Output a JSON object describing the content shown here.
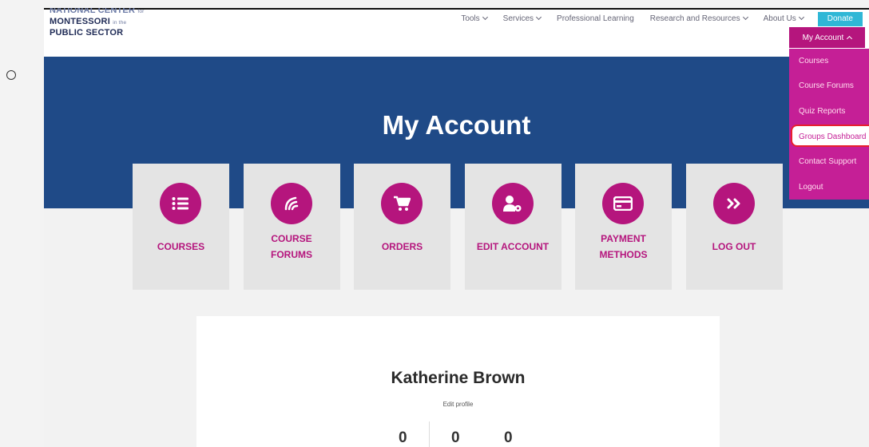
{
  "logo": {
    "line1": "NATIONAL CENTER",
    "line1_small": "for",
    "line2": "MONTESSORI",
    "line2_small": "in the",
    "line3": "PUBLIC SECTOR"
  },
  "nav": {
    "tools": "Tools",
    "services": "Services",
    "professional": "Professional Learning",
    "research": "Research and Resources",
    "about": "About Us",
    "donate": "Donate"
  },
  "account_menu": {
    "label": "My Account",
    "items": [
      "Courses",
      "Course Forums",
      "Quiz Reports",
      "Groups Dashboard",
      "Contact Support",
      "Logout"
    ]
  },
  "hero": {
    "title": "My Account"
  },
  "cards": [
    {
      "icon": "list-icon",
      "label": "COURSES"
    },
    {
      "icon": "forum-icon",
      "label": "COURSE FORUMS"
    },
    {
      "icon": "cart-icon",
      "label": "ORDERS"
    },
    {
      "icon": "user-gear-icon",
      "label": "EDIT ACCOUNT"
    },
    {
      "icon": "credit-card-icon",
      "label": "PAYMENT METHODS"
    },
    {
      "icon": "double-chevron-right-icon",
      "label": "LOG OUT"
    }
  ],
  "profile": {
    "name": "Katherine Brown",
    "edit": "Edit profile",
    "stats": [
      "0",
      "0",
      "0"
    ]
  },
  "colors": {
    "brand": "#b5157d",
    "hero": "#1f4a87",
    "donate": "#2fb7d6",
    "highlight": "#e8202e"
  }
}
